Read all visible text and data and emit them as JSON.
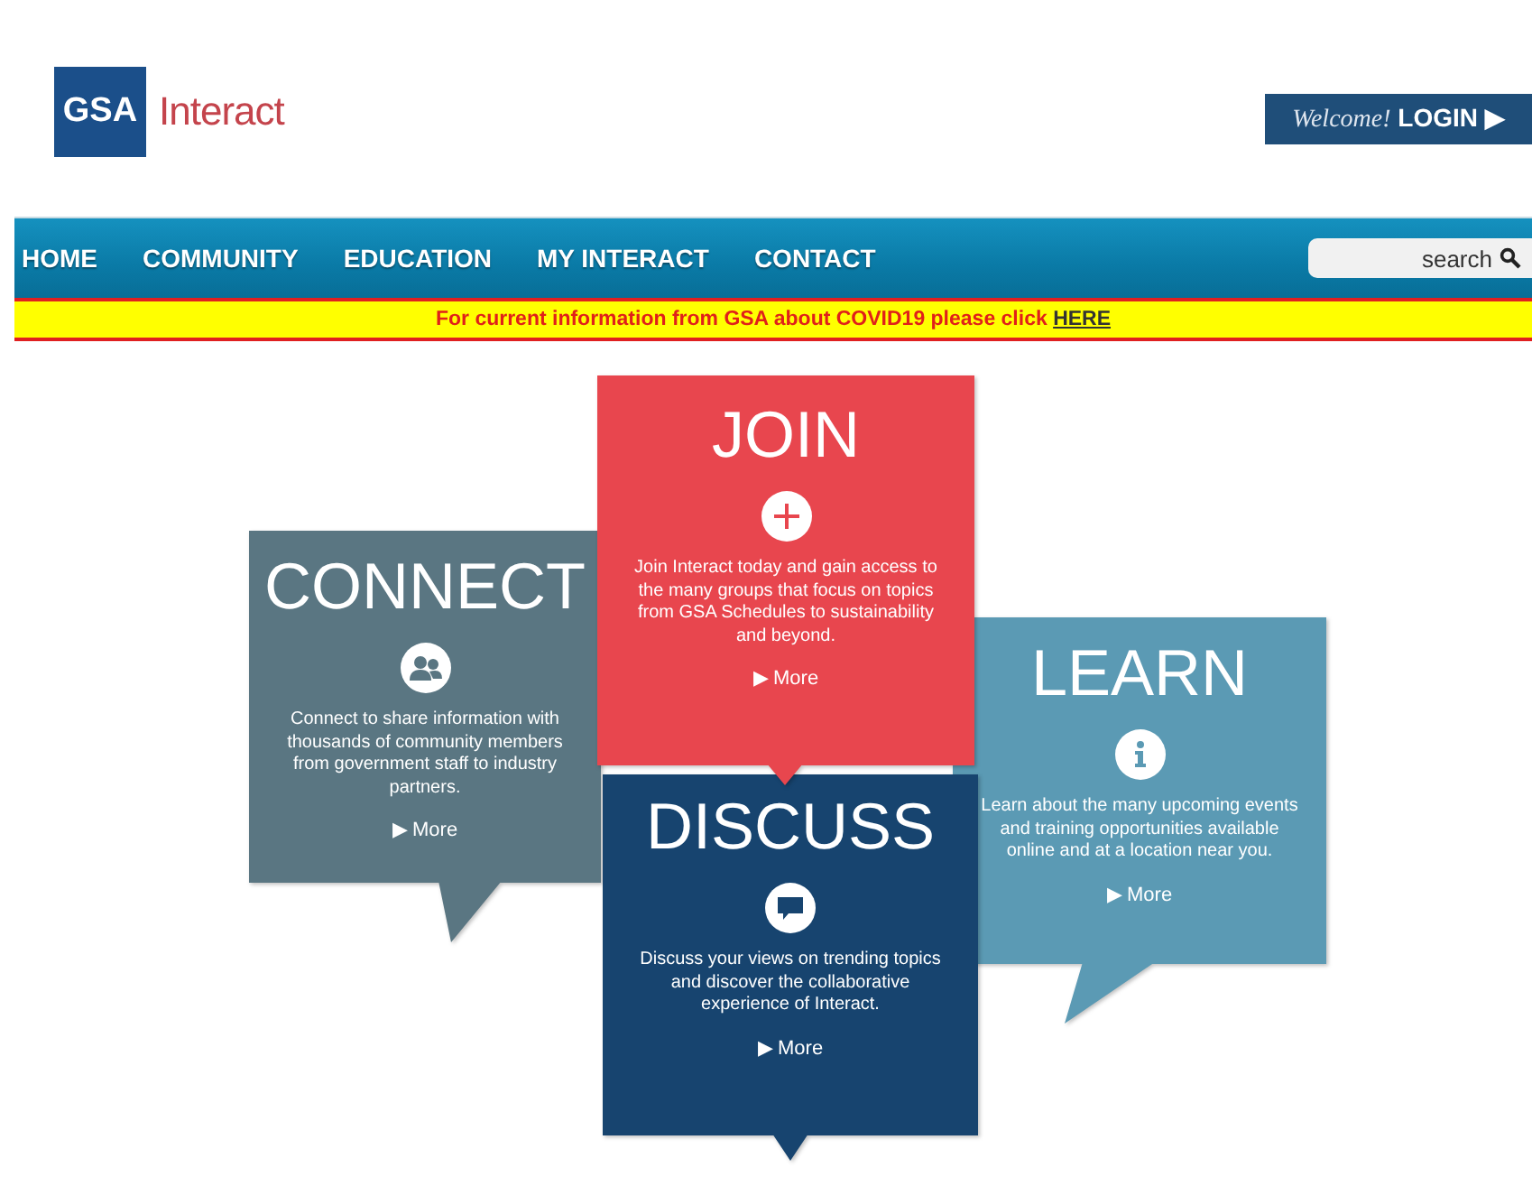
{
  "header": {
    "logo_mark": "GSA",
    "logo_text": "Interact",
    "login": {
      "greeting": "Welcome!",
      "label": "LOGIN ▶"
    }
  },
  "nav": {
    "items": [
      {
        "label": "HOME"
      },
      {
        "label": "COMMUNITY"
      },
      {
        "label": "EDUCATION"
      },
      {
        "label": "MY INTERACT"
      },
      {
        "label": "CONTACT"
      }
    ],
    "search": {
      "placeholder": "search"
    }
  },
  "banner": {
    "text": "For current information from GSA about COVID19 please click",
    "link": "HERE"
  },
  "tiles": [
    {
      "kind": "join",
      "title": "JOIN",
      "color": "#e8464e",
      "description": "Join Interact today and gain access to the many groups that focus on topics from GSA Schedules to sustainability and beyond.",
      "more": "▶ More"
    },
    {
      "kind": "connect",
      "title": "CONNECT",
      "color": "#5a7682",
      "description": "Connect to share information with thousands of community members from government staff to industry partners.",
      "more": "▶ More"
    },
    {
      "kind": "learn",
      "title": "LEARN",
      "color": "#5b9ab4",
      "description": "Learn about the many upcoming events and training opportunities available online and at a location near you.",
      "more": "▶ More"
    },
    {
      "kind": "discuss",
      "title": "DISCUSS",
      "color": "#17446f",
      "description": "Discuss your views on trending topics and discover the collaborative experience of Interact.",
      "more": "▶ More"
    }
  ]
}
